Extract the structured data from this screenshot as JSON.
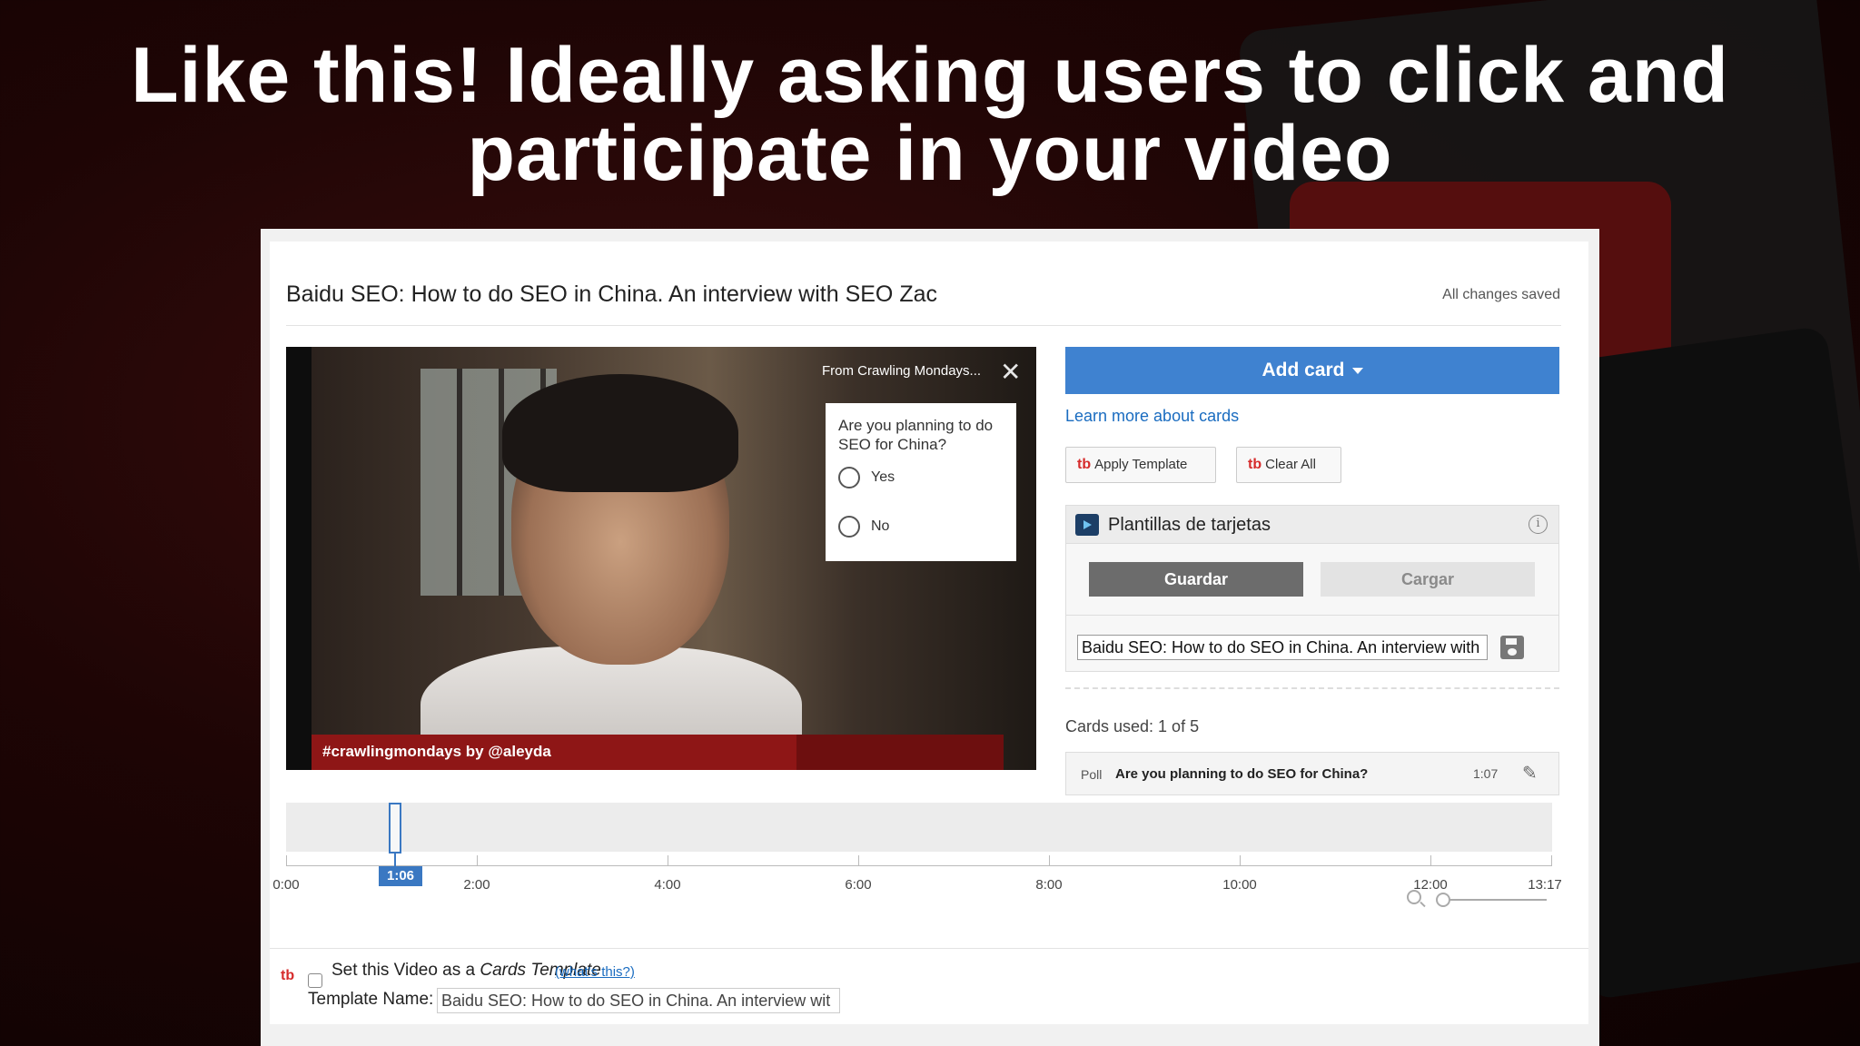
{
  "headline": {
    "line1": "Like this! Ideally asking users to click and",
    "line2": "participate in your video"
  },
  "editor": {
    "video_title": "Baidu SEO: How to do SEO in China. An interview with SEO Zac",
    "save_status": "All changes saved"
  },
  "video": {
    "lower_third": "#crawlingmondays by @aleyda",
    "card_teaser": "From Crawling Mondays...",
    "poll": {
      "question": "Are you planning to do SEO for China?",
      "options": [
        "Yes",
        "No"
      ]
    }
  },
  "sidebar": {
    "add_card_label": "Add card",
    "learn_more": "Learn more about cards",
    "tb_logo": "tb",
    "apply_template": "Apply Template",
    "clear_all": "Clear All",
    "templates_title": "Plantillas de tarjetas",
    "info_glyph": "i",
    "guardar": "Guardar",
    "cargar": "Cargar",
    "template_input_value": "Baidu SEO: How to do SEO in China. An interview with",
    "cards_used": "Cards used: 1 of 5",
    "card_item": {
      "type": "Poll",
      "title": "Are you planning to do SEO for China?",
      "time": "1:07"
    }
  },
  "timeline": {
    "labels": [
      "0:00",
      "2:00",
      "4:00",
      "6:00",
      "8:00",
      "10:00",
      "12:00",
      "13:17"
    ],
    "current_time": "1:06"
  },
  "bottom": {
    "tb_logo": "tb",
    "set_template_prefix": "Set this Video as a",
    "set_template_italic": "Cards Template",
    "whats_this": "(what's this?)",
    "template_name_label": "Template Name:",
    "template_name_value": "Baidu SEO: How to do SEO in China. An interview wit"
  },
  "colors": {
    "accent_blue": "#3f82d0",
    "brand_red": "#d62b2b",
    "lower_third_red": "#8e1616"
  }
}
